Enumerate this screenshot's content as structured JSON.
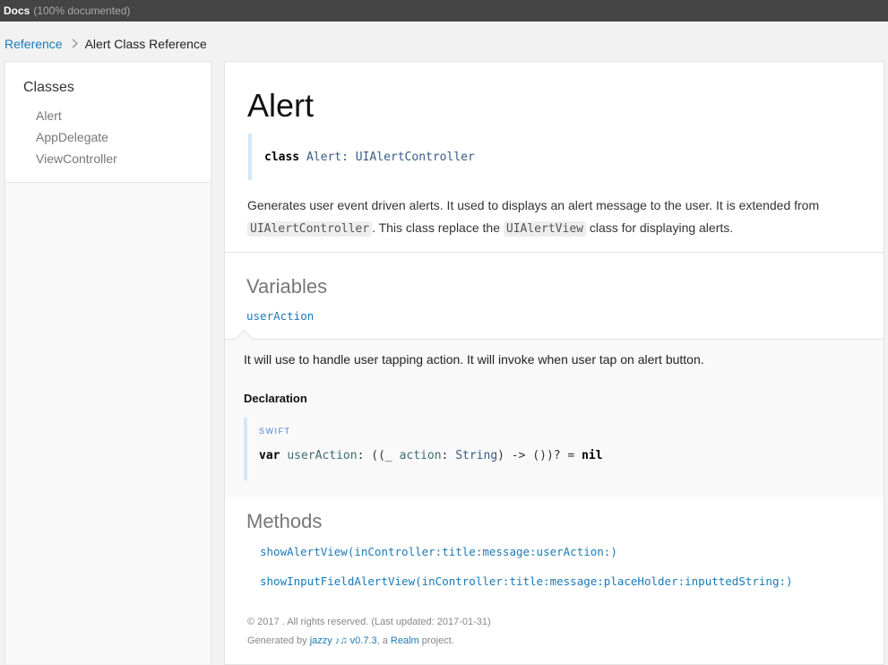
{
  "header": {
    "brand": "Docs",
    "coverage": "(100% documented)"
  },
  "breadcrumb": {
    "root": "Reference",
    "current": "Alert Class Reference"
  },
  "sidebar": {
    "group_title": "Classes",
    "items": [
      {
        "label": "Alert"
      },
      {
        "label": "AppDelegate"
      },
      {
        "label": "ViewController"
      }
    ]
  },
  "main": {
    "title": "Alert",
    "declaration": {
      "keyword": "class",
      "name": "Alert",
      "colon": ":",
      "superclass": "UIAlertController"
    },
    "abstract": {
      "part1": "Generates user event driven alerts. It used to displays an alert message to the user. It is extended from",
      "code1": "UIAlertController",
      "part2": ". This class replace the",
      "code2": "UIAlertView",
      "part3": "class for displaying alerts."
    },
    "variables": {
      "title": "Variables",
      "token": "userAction",
      "description": "It will use to handle user tapping action. It will invoke when user tap on alert button.",
      "declaration_title": "Declaration",
      "language": "SWIFT",
      "code": {
        "kw_var": "var",
        "name": "userAction",
        "sig": ": ((_",
        "param": "action",
        "colon": ":",
        "type": "String",
        "rest": ") -> ())? =",
        "kw_nil": "nil"
      }
    },
    "methods": {
      "title": "Methods",
      "items": [
        {
          "label": "showAlertView(inController:title:message:userAction:)"
        },
        {
          "label": "showInputFieldAlertView(inController:title:message:placeHolder:inputtedString:)"
        }
      ]
    },
    "footer": {
      "copyright": "© 2017 . All rights reserved. (Last updated: 2017-01-31)",
      "generated_prefix": "Generated by",
      "generator_link": "jazzy ♪♫ v0.7.3",
      "generated_middle": ", a",
      "realm_link": "Realm",
      "generated_suffix": "project."
    }
  }
}
